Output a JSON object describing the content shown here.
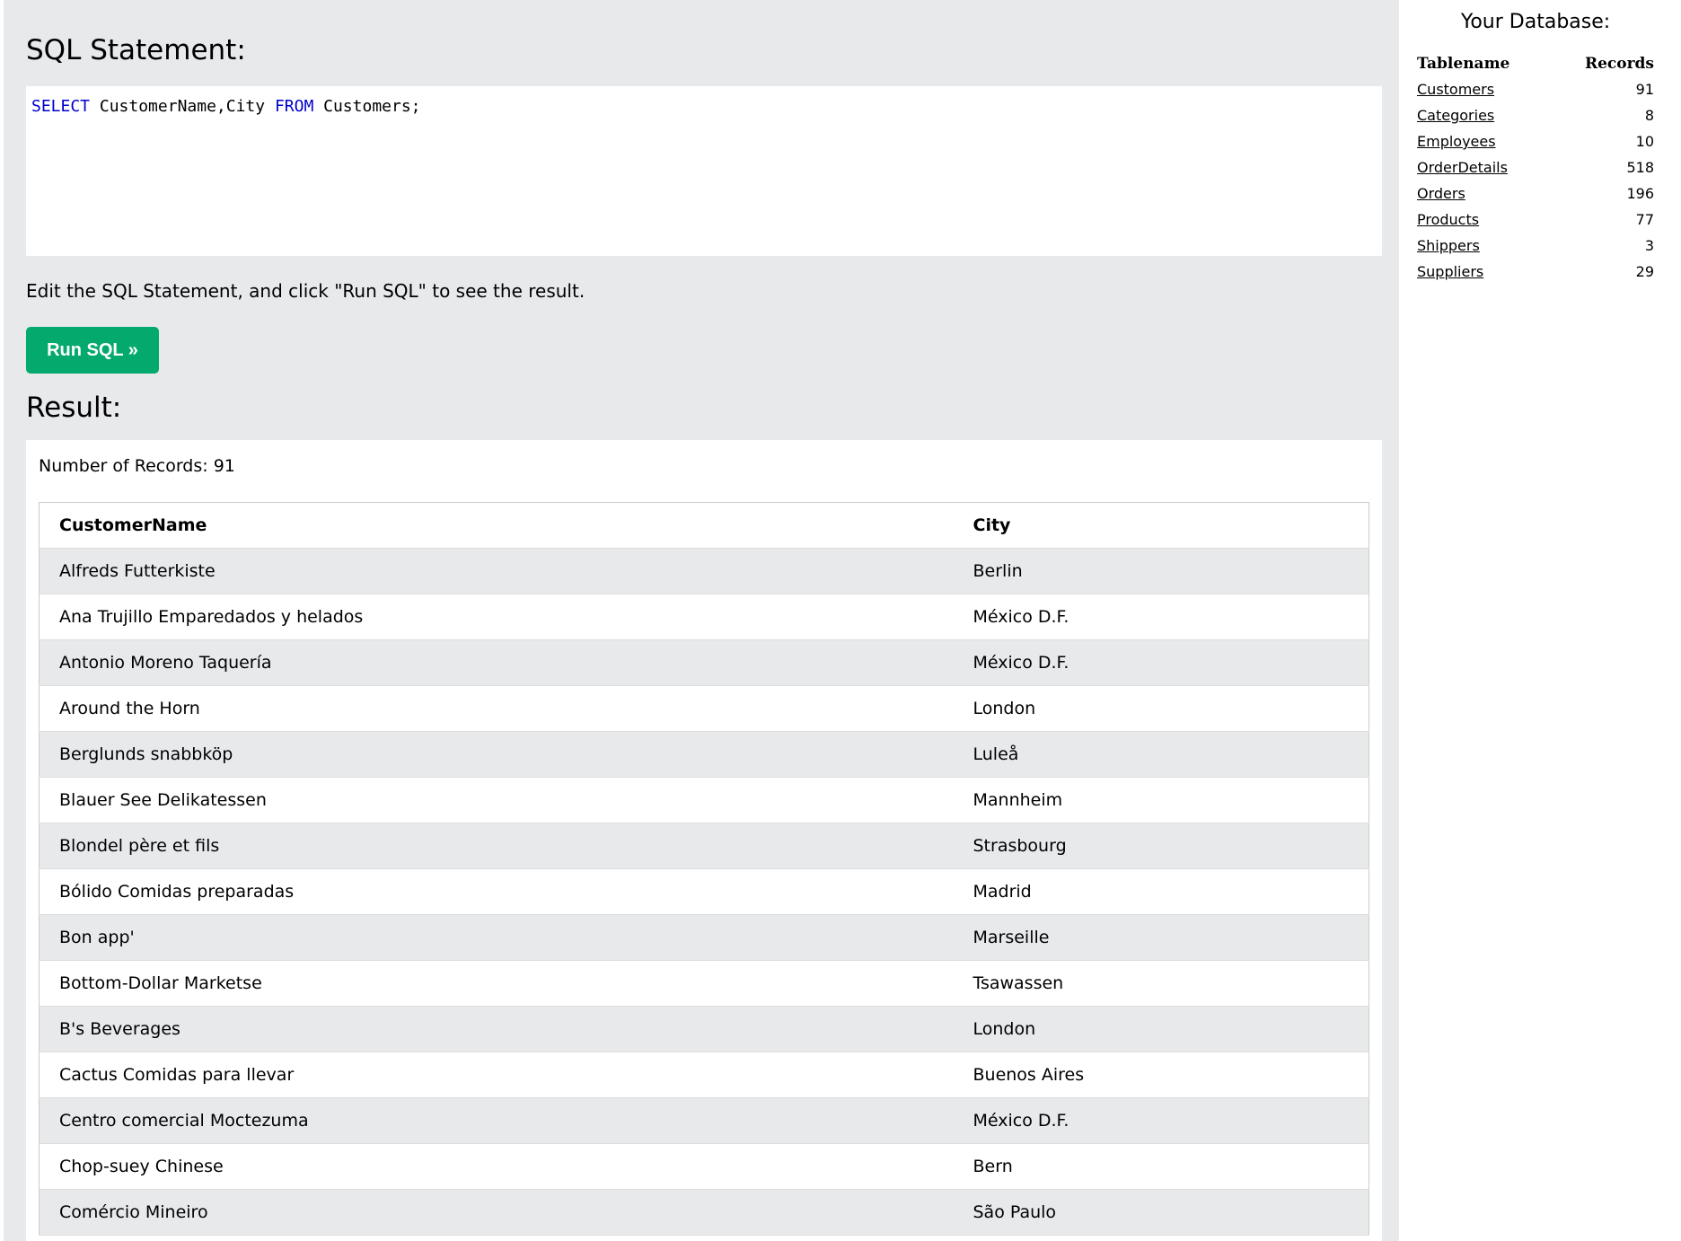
{
  "sql": {
    "heading": "SQL Statement:",
    "statement": {
      "kw_select": "SELECT",
      "columns": " CustomerName,City ",
      "kw_from": "FROM",
      "table": " Customers;"
    },
    "helper_text": "Edit the SQL Statement, and click \"Run SQL\" to see the result.",
    "run_button": "Run SQL »"
  },
  "result": {
    "heading": "Result:",
    "record_count": "Number of Records: 91",
    "columns": [
      "CustomerName",
      "City"
    ],
    "rows": [
      [
        "Alfreds Futterkiste",
        "Berlin"
      ],
      [
        "Ana Trujillo Emparedados y helados",
        "México D.F."
      ],
      [
        "Antonio Moreno Taquería",
        "México D.F."
      ],
      [
        "Around the Horn",
        "London"
      ],
      [
        "Berglunds snabbköp",
        "Luleå"
      ],
      [
        "Blauer See Delikatessen",
        "Mannheim"
      ],
      [
        "Blondel père et fils",
        "Strasbourg"
      ],
      [
        "Bólido Comidas preparadas",
        "Madrid"
      ],
      [
        "Bon app'",
        "Marseille"
      ],
      [
        "Bottom-Dollar Marketse",
        "Tsawassen"
      ],
      [
        "B's Beverages",
        "London"
      ],
      [
        "Cactus Comidas para llevar",
        "Buenos Aires"
      ],
      [
        "Centro comercial Moctezuma",
        "México D.F."
      ],
      [
        "Chop-suey Chinese",
        "Bern"
      ],
      [
        "Comércio Mineiro",
        "São Paulo"
      ]
    ]
  },
  "database": {
    "title": "Your Database:",
    "columns": [
      "Tablename",
      "Records"
    ],
    "tables": [
      {
        "name": "Customers",
        "records": "91"
      },
      {
        "name": "Categories",
        "records": "8"
      },
      {
        "name": "Employees",
        "records": "10"
      },
      {
        "name": "OrderDetails",
        "records": "518"
      },
      {
        "name": "Orders",
        "records": "196"
      },
      {
        "name": "Products",
        "records": "77"
      },
      {
        "name": "Shippers",
        "records": "3"
      },
      {
        "name": "Suppliers",
        "records": "29"
      }
    ]
  },
  "colors": {
    "run_button": "#04aa6d",
    "pane_background": "#e7e9eb",
    "sql_keyword": "#0000cd"
  }
}
